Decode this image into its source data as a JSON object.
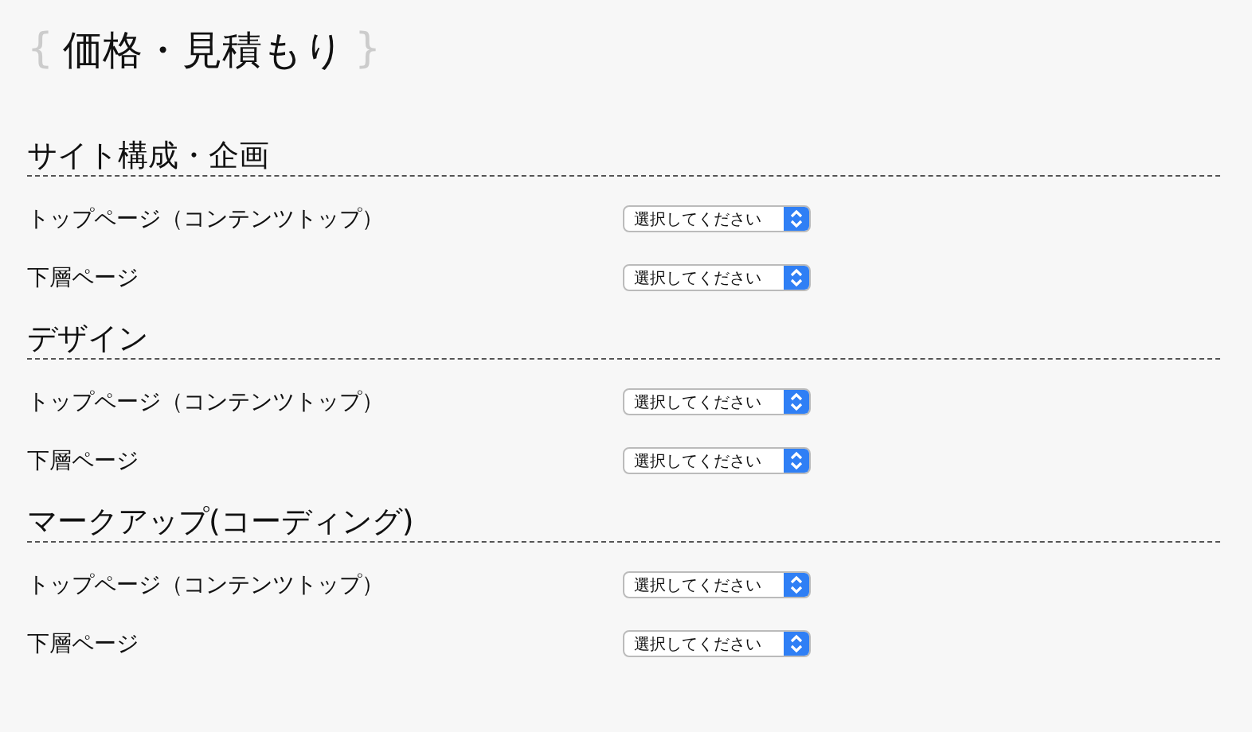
{
  "page_title": {
    "open_brace": "{",
    "text": "価格・見積もり",
    "close_brace": "}"
  },
  "sections": [
    {
      "heading": "サイト構成・企画",
      "rows": [
        {
          "label": "トップページ（コンテンツトップ）",
          "select": "選択してください"
        },
        {
          "label": "下層ページ",
          "select": "選択してください"
        }
      ]
    },
    {
      "heading": "デザイン",
      "rows": [
        {
          "label": "トップページ（コンテンツトップ）",
          "select": "選択してください"
        },
        {
          "label": "下層ページ",
          "select": "選択してください"
        }
      ]
    },
    {
      "heading": "マークアップ(コーディング)",
      "rows": [
        {
          "label": "トップページ（コンテンツトップ）",
          "select": "選択してください"
        },
        {
          "label": "下層ページ",
          "select": "選択してください"
        }
      ]
    }
  ]
}
